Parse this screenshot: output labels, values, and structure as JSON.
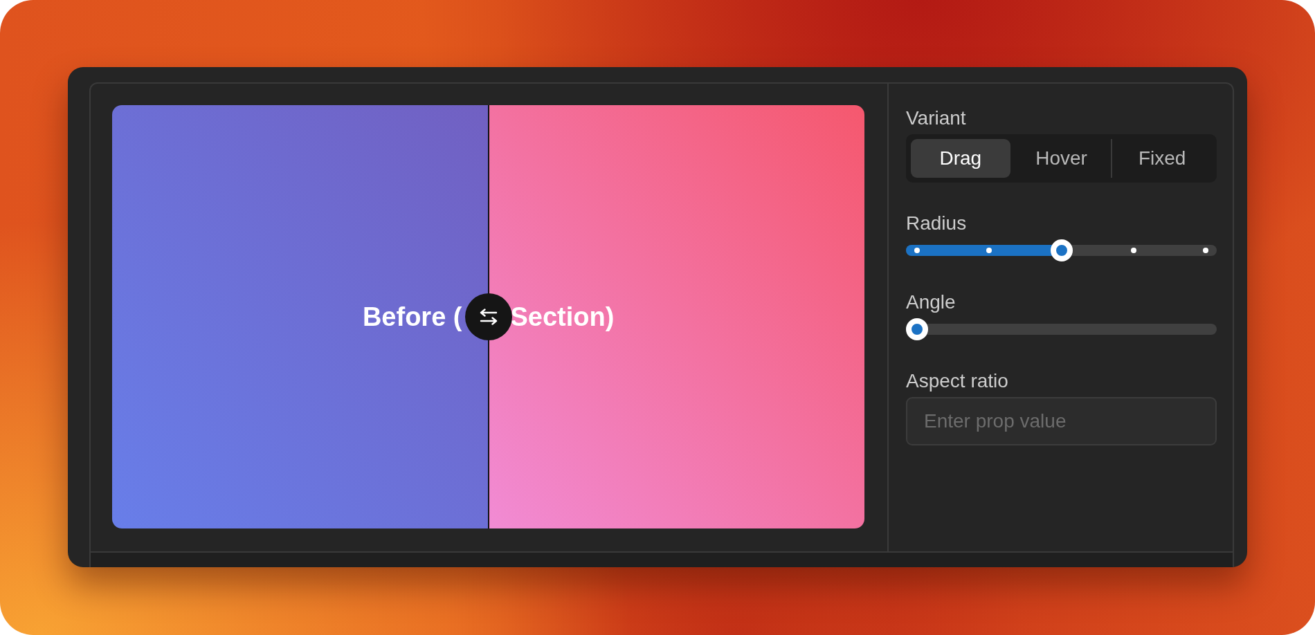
{
  "comparison": {
    "before_text": "Before (",
    "after_text": "Section)",
    "level": 0.5
  },
  "properties": [
    {
      "kind": "segmented",
      "label": "Variant",
      "options": [
        {
          "label": "Drag",
          "selected": true
        },
        {
          "label": "Hover",
          "selected": false
        },
        {
          "label": "Fixed",
          "selected": false
        }
      ]
    },
    {
      "kind": "stepped_slider",
      "label": "Radius",
      "level": 0.5
    },
    {
      "kind": "slider",
      "label": "Angle",
      "level": 0
    },
    {
      "kind": "text_input",
      "label": "Aspect ratio",
      "placeholder": "Enter prop value"
    }
  ]
}
